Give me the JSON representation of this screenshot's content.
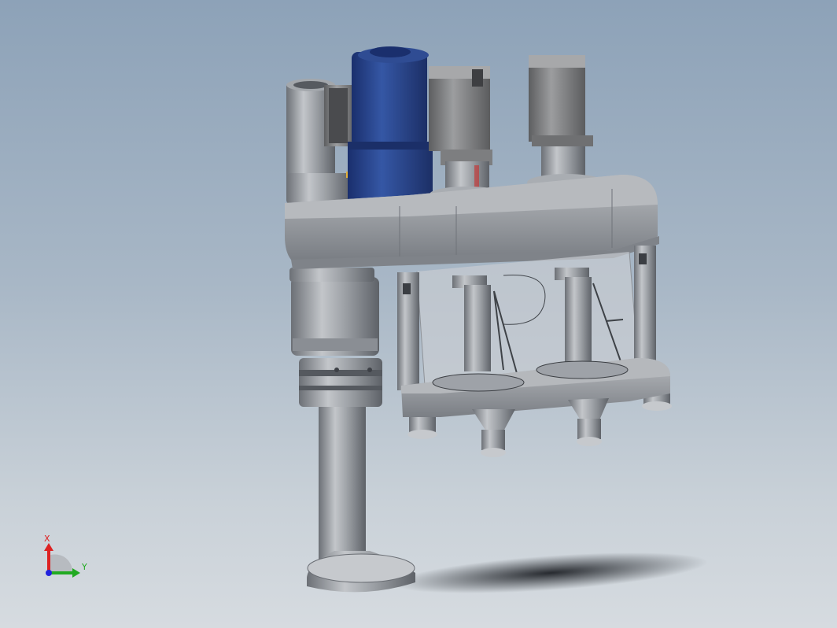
{
  "viewport": {
    "background_top": "#8da2b8",
    "background_bottom": "#d6dbe0"
  },
  "model": {
    "parts": [
      "main-column",
      "base-foot",
      "top-plate",
      "blue-motor",
      "servo-motor-left",
      "servo-motor-right",
      "clear-cylinder",
      "bottom-plate",
      "guide-rod-left",
      "guide-rod-right",
      "spindle-left",
      "spindle-right",
      "nozzle-left",
      "nozzle-right"
    ],
    "colors": {
      "steel": "#9a9ea4",
      "steel_dark": "#6d7177",
      "motor_blue": "#25408a",
      "motor_grey": "#7f7f80",
      "glass": "#c7ccd3",
      "shadow": "#262a30"
    }
  },
  "triad": {
    "x_label": "X",
    "y_label": "Y",
    "x_color": "#dd2222",
    "y_color": "#22aa22",
    "z_color": "#2222dd"
  }
}
